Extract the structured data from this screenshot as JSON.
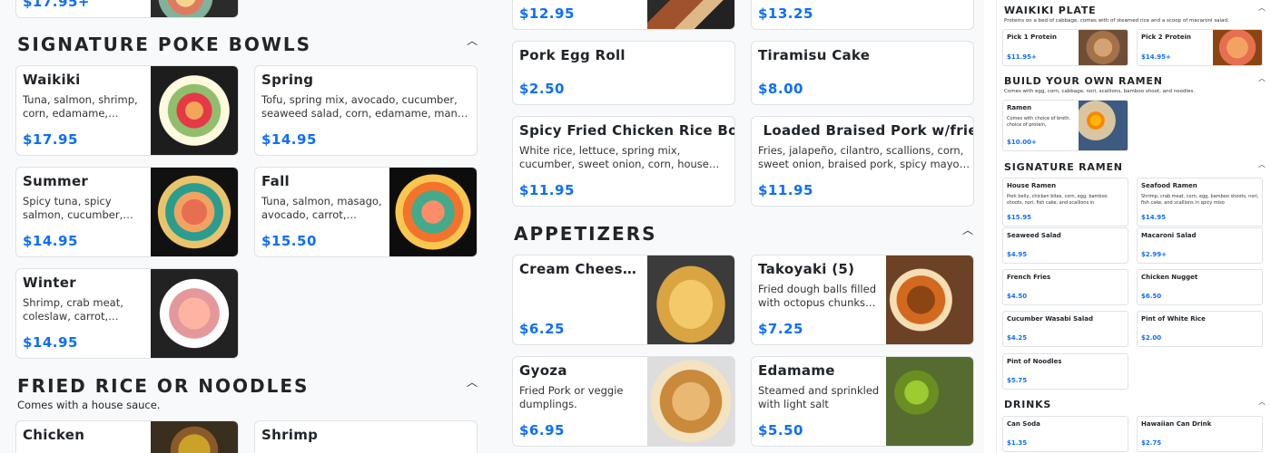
{
  "left": {
    "top_card": {
      "price": "$17.95+"
    },
    "sections": {
      "signature_poke": {
        "title": "SIGNATURE POKE BOWLS",
        "items": [
          {
            "name": "Waikiki",
            "desc": "Tuna, salmon, shrimp, corn, edamame, cucumber,",
            "price": "$17.95"
          },
          {
            "name": "Spring",
            "desc": "Tofu, spring mix, avocado, cucumber, seaweed salad, corn, edamame, mango, carrot with",
            "price": "$14.95"
          },
          {
            "name": "Summer",
            "desc": "Spicy tuna, spicy salmon, cucumber, corn, jalapeno",
            "price": "$14.95"
          },
          {
            "name": "Fall",
            "desc": "Tuna, salmon, masago, avocado, carrot, edamam",
            "price": "$15.50"
          },
          {
            "name": "Winter",
            "desc": "Shrimp, crab meat, coleslaw, carrot, cucumb",
            "price": "$14.95"
          }
        ]
      },
      "fried_rice": {
        "title": "FRIED RICE OR NOODLES",
        "subtitle": "Comes with a house sauce.",
        "items": [
          {
            "name": "Chicken"
          },
          {
            "name": "Shrimp"
          }
        ]
      }
    }
  },
  "mid": {
    "top_cards": [
      {
        "price": "$12.95"
      },
      {
        "price": "$13.25"
      }
    ],
    "items": [
      {
        "name": "Pork Egg Roll",
        "price": "$2.50"
      },
      {
        "name": "Tiramisu Cake",
        "price": "$8.00"
      },
      {
        "name": "Spicy Fried Chicken Rice Bowl",
        "desc": "White rice, lettuce, spring mix, cucumber, sweet onion, corn, house made honey sauce,",
        "price": "$11.95"
      },
      {
        "name": " Loaded Braised Pork w/fries",
        "desc": "Fries, jalapeño, cilantro, scallions, corn, sweet onion, braised pork, spicy mayo, hot sauce,",
        "price": "$11.95"
      }
    ],
    "appetizers": {
      "title": "APPETIZERS",
      "items": [
        {
          "name": "Cream Cheese...",
          "desc": "",
          "price": "$6.25"
        },
        {
          "name": "Takoyaki (5)",
          "desc": "Fried dough balls filled with octopus chunks topped",
          "price": "$7.25"
        },
        {
          "name": "Gyoza",
          "desc": "Fried Pork or veggie dumplings.",
          "price": "$6.95"
        },
        {
          "name": "Edamame",
          "desc": "Steamed and sprinkled with light salt",
          "price": "$5.50"
        }
      ]
    }
  },
  "right": {
    "waikiki_plate": {
      "title": "WAIKIKI PLATE",
      "subtitle": "Proteins on a bed of cabbage, comes with of steamed rice and a scoop of macaroni salad.",
      "items": [
        {
          "name": "Pick 1 Protein",
          "price": "$11.95+"
        },
        {
          "name": "Pick 2 Protein",
          "price": "$14.95+"
        }
      ]
    },
    "build_ramen": {
      "title": "BUILD YOUR OWN RAMEN",
      "subtitle": "Comes with egg, corn, cabbage, nori, scallions, bamboo shoot, and noodles.",
      "items": [
        {
          "name": "Ramen",
          "desc": "Comes with choice of broth, choice of protein,",
          "price": "$10.00+"
        }
      ]
    },
    "signature_ramen": {
      "title": "SIGNATURE RAMEN",
      "items": [
        {
          "name": "House Ramen",
          "desc": "Pork belly, chicken bites, corn, egg, bamboo shoots, nori, fish cake, and scallions in",
          "price": "$15.95"
        },
        {
          "name": "Seafood Ramen",
          "desc": "Shrimp, crab meat, corn, egg, bamboo shoots, nori, fish cake, and scallions in spicy miso",
          "price": "$14.95"
        },
        {
          "name": "Seaweed Salad",
          "price": "$4.95"
        },
        {
          "name": "Macaroni Salad",
          "price": "$2.99+"
        },
        {
          "name": "French Fries",
          "price": "$4.50"
        },
        {
          "name": "Chicken Nugget",
          "price": "$6.50"
        },
        {
          "name": "Cucumber Wasabi Salad",
          "price": "$4.25"
        },
        {
          "name": "Pint of White Rice",
          "price": "$2.00"
        },
        {
          "name": "Pint of Noodles",
          "price": "$5.75"
        }
      ]
    },
    "drinks": {
      "title": "DRINKS",
      "items": [
        {
          "name": "Can Soda",
          "price": "$1.35"
        },
        {
          "name": "Hawaiian Can Drink",
          "price": "$2.75"
        }
      ]
    }
  },
  "colors": {
    "price": "#0d6efd",
    "border": "#dee2e6",
    "background": "#f8f9fa"
  },
  "icons": {
    "collapse": "chevron-up-icon"
  }
}
